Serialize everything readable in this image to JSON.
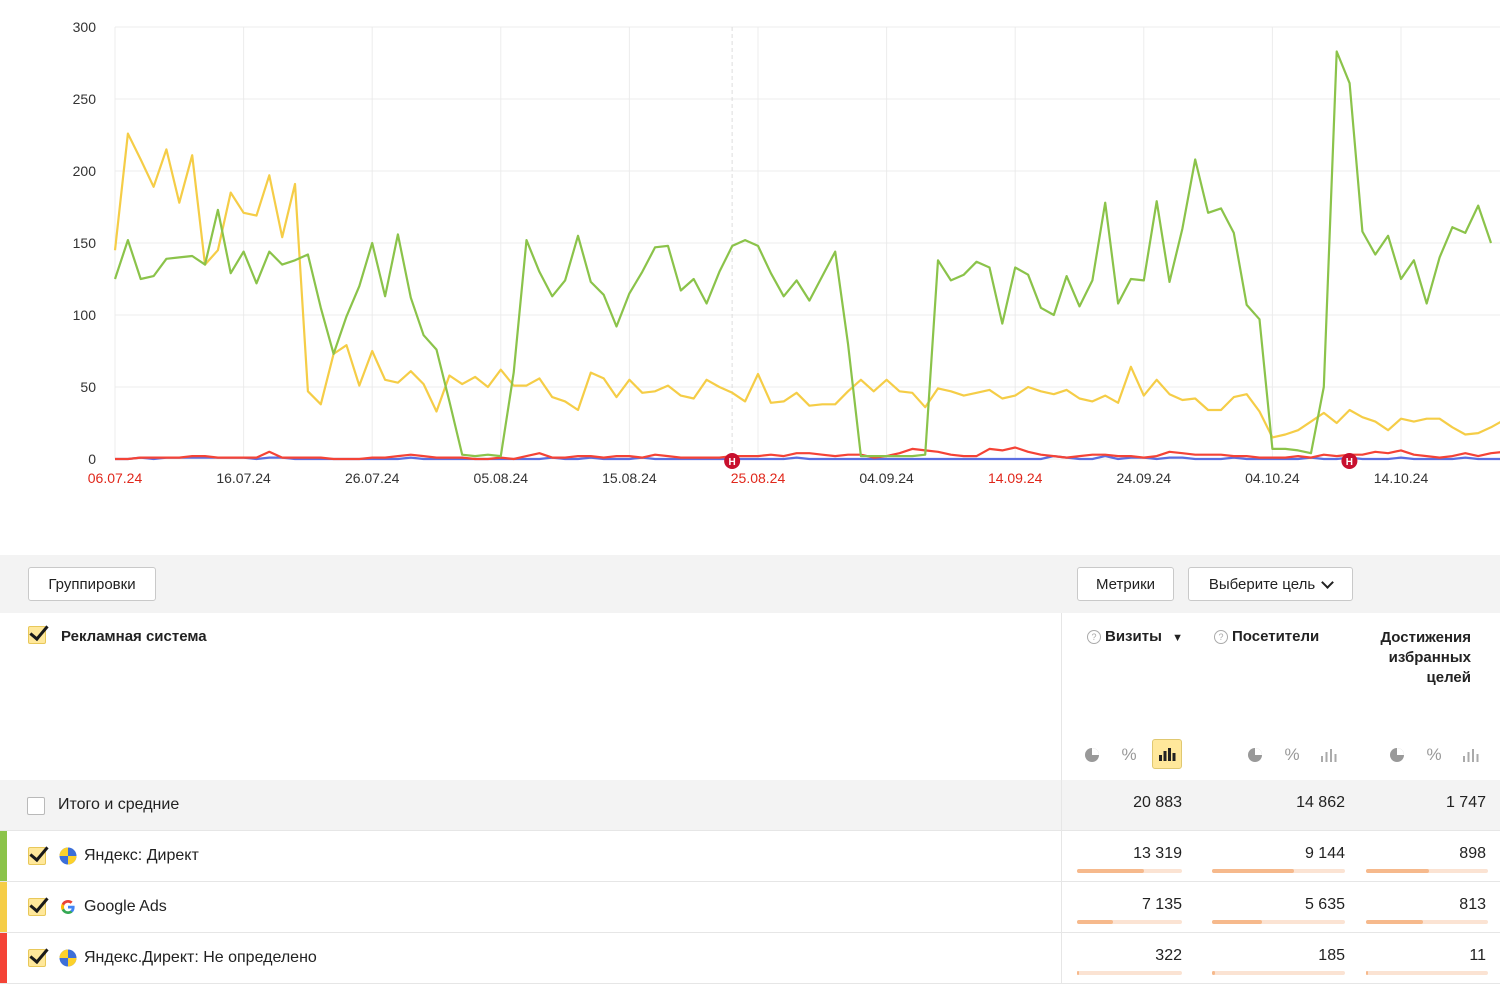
{
  "chart_data": {
    "type": "line",
    "y_ticks": [
      "0",
      "50",
      "100",
      "150",
      "200",
      "250",
      "300"
    ],
    "ylim": [
      0,
      300
    ],
    "x_ticks": [
      {
        "label": "06.07.24",
        "red": true
      },
      {
        "label": "16.07.24",
        "red": false
      },
      {
        "label": "26.07.24",
        "red": false
      },
      {
        "label": "05.08.24",
        "red": false
      },
      {
        "label": "15.08.24",
        "red": false
      },
      {
        "label": "25.08.24",
        "red": true
      },
      {
        "label": "04.09.24",
        "red": false
      },
      {
        "label": "14.09.24",
        "red": true
      },
      {
        "label": "24.09.24",
        "red": false
      },
      {
        "label": "04.10.24",
        "red": false
      },
      {
        "label": "14.10.24",
        "red": false
      }
    ],
    "x_start": "06.07.24",
    "series": [
      {
        "color": "#8bc34a",
        "values": [
          125,
          152,
          125,
          127,
          139,
          140,
          141,
          135,
          173,
          129,
          144,
          122,
          144,
          135,
          138,
          142,
          105,
          73,
          99,
          120,
          150,
          113,
          156,
          112,
          86,
          76,
          40,
          3,
          2,
          3,
          2,
          60,
          152,
          130,
          113,
          124,
          155,
          123,
          114,
          92,
          115,
          130,
          147,
          148,
          117,
          125,
          108,
          130,
          148,
          152,
          148,
          129,
          113,
          124,
          110,
          127,
          144,
          80,
          2,
          2,
          2,
          2,
          2,
          3,
          138,
          124,
          128,
          137,
          133,
          94,
          133,
          128,
          105,
          100,
          127,
          106,
          124,
          178,
          108,
          125,
          124,
          179,
          123,
          160,
          208,
          171,
          174,
          157,
          107,
          97,
          7,
          7,
          6,
          4,
          50,
          283,
          261,
          158,
          142,
          155,
          125,
          138,
          108,
          140,
          161,
          157,
          176,
          150
        ]
      },
      {
        "color": "#f5cd47",
        "values": [
          145,
          226,
          208,
          189,
          215,
          178,
          211,
          135,
          145,
          185,
          171,
          169,
          197,
          154,
          191,
          47,
          38,
          73,
          79,
          51,
          75,
          55,
          53,
          61,
          52,
          33,
          58,
          52,
          57,
          50,
          62,
          51,
          51,
          56,
          43,
          40,
          34,
          60,
          56,
          43,
          55,
          46,
          47,
          51,
          44,
          42,
          55,
          50,
          46,
          40,
          59,
          39,
          40,
          46,
          37,
          38,
          38,
          47,
          55,
          47,
          55,
          47,
          46,
          36,
          49,
          47,
          44,
          46,
          48,
          42,
          44,
          50,
          47,
          45,
          48,
          42,
          40,
          44,
          39,
          64,
          44,
          55,
          45,
          41,
          42,
          34,
          34,
          43,
          45,
          33,
          15,
          17,
          20,
          26,
          32,
          25,
          34,
          29,
          26,
          20,
          28,
          26,
          28,
          28,
          22,
          17,
          18,
          22,
          27
        ]
      },
      {
        "color": "#f44336",
        "values": [
          0,
          0,
          1,
          1,
          1,
          1,
          2,
          2,
          1,
          1,
          1,
          1,
          5,
          1,
          1,
          1,
          1,
          0,
          0,
          0,
          1,
          1,
          2,
          3,
          2,
          1,
          1,
          1,
          0,
          0,
          1,
          0,
          2,
          4,
          1,
          1,
          2,
          2,
          1,
          2,
          2,
          1,
          3,
          2,
          1,
          1,
          1,
          1,
          2,
          2,
          2,
          3,
          2,
          4,
          4,
          3,
          2,
          3,
          3,
          1,
          2,
          4,
          7,
          6,
          5,
          3,
          2,
          2,
          7,
          6,
          8,
          5,
          3,
          2,
          1,
          2,
          3,
          3,
          2,
          2,
          1,
          2,
          5,
          4,
          3,
          3,
          3,
          2,
          2,
          1,
          1,
          1,
          2,
          1,
          3,
          2,
          3,
          3,
          5,
          4,
          6,
          3,
          2,
          1,
          2,
          4,
          2,
          4,
          5
        ]
      },
      {
        "color": "#5b6ee1",
        "values": [
          0,
          0,
          1,
          0,
          1,
          1,
          1,
          1,
          1,
          1,
          1,
          0,
          1,
          1,
          0,
          0,
          0,
          0,
          0,
          0,
          0,
          0,
          0,
          1,
          0,
          0,
          0,
          0,
          0,
          0,
          0,
          0,
          0,
          0,
          1,
          0,
          0,
          1,
          0,
          0,
          0,
          1,
          0,
          0,
          0,
          0,
          0,
          0,
          0,
          0,
          0,
          0,
          0,
          1,
          0,
          0,
          0,
          0,
          0,
          0,
          0,
          0,
          0,
          0,
          0,
          0,
          0,
          0,
          0,
          0,
          0,
          0,
          0,
          2,
          1,
          0,
          0,
          2,
          0,
          1,
          1,
          0,
          1,
          1,
          0,
          0,
          0,
          1,
          0,
          0,
          0,
          0,
          0,
          1,
          0,
          0,
          1,
          0,
          0,
          0,
          1,
          0,
          0,
          0,
          0,
          1,
          0,
          0,
          0
        ]
      }
    ],
    "markers": [
      {
        "index": 49,
        "label": "Н"
      },
      {
        "index": 97,
        "label": "Н"
      }
    ]
  },
  "toolbar": {
    "groupings": "Группировки",
    "metrics": "Метрики",
    "goal": "Выберите цель"
  },
  "table": {
    "dimension_header": "Рекламная система",
    "columns": [
      {
        "title": "Визиты",
        "sort": "▼",
        "help": "?"
      },
      {
        "title": "Посетители",
        "help": "?"
      },
      {
        "title_lines": [
          "Достижения",
          "избранных",
          "целей"
        ]
      }
    ],
    "view_icons": {
      "pie": "pie-chart-icon",
      "percent": "%",
      "bars": "bar-chart-icon"
    },
    "total": {
      "label": "Итого и средние",
      "values": [
        "20 883",
        "14 862",
        "1 747"
      ]
    },
    "rows": [
      {
        "label": "Яндекс: Директ",
        "values": [
          "13 319",
          "9 144",
          "898"
        ],
        "stripe": "#8bc34a",
        "shares": [
          0.638,
          0.615,
          0.514
        ],
        "logo": "yandex-direct-logo"
      },
      {
        "label": "Google Ads",
        "values": [
          "7 135",
          "5 635",
          "813"
        ],
        "stripe": "#f5cd47",
        "shares": [
          0.342,
          0.379,
          0.465
        ],
        "logo": "google-logo"
      },
      {
        "label": "Яндекс.Директ: Не определено",
        "values": [
          "322",
          "185",
          "11"
        ],
        "stripe": "#f44336",
        "shares": [
          0.015,
          0.012,
          0.006
        ],
        "logo": "yandex-direct-logo"
      }
    ]
  }
}
